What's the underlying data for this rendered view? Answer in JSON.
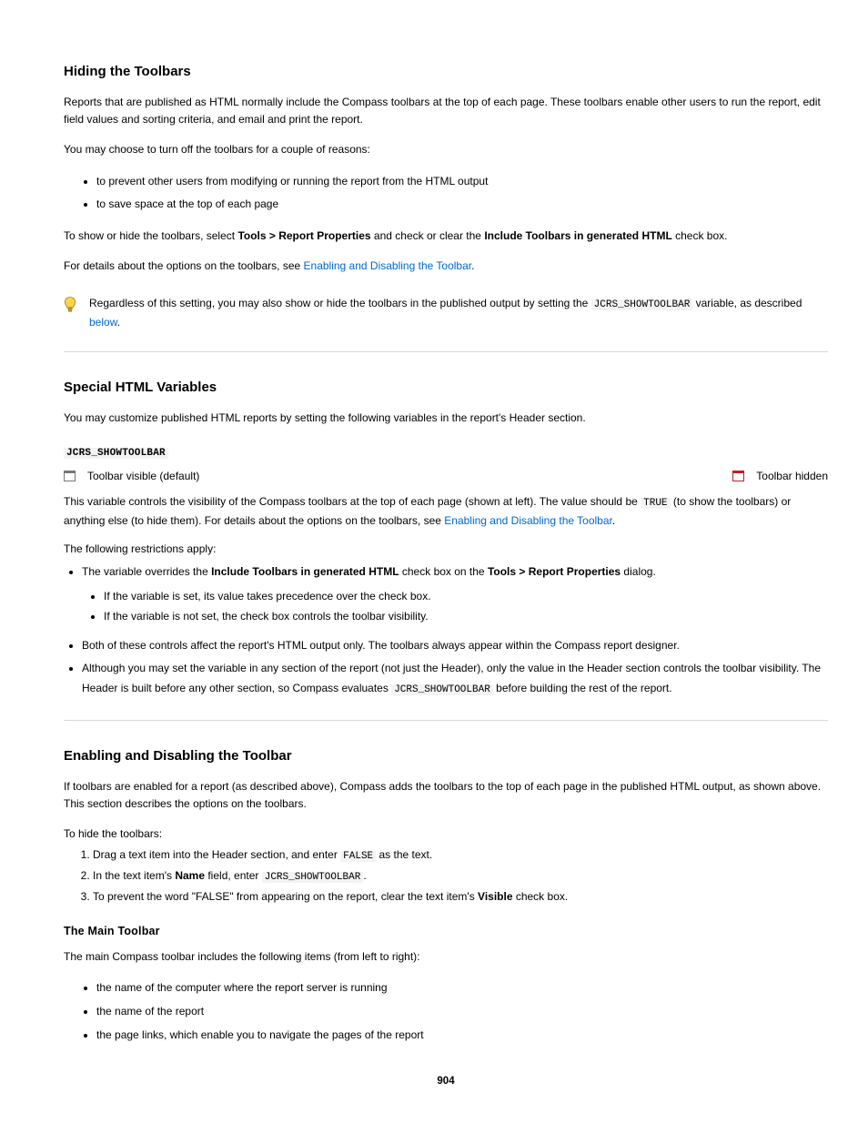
{
  "sec1": {
    "title": "Hiding the Toolbars",
    "p1": "Reports that are published as HTML normally include the Compass toolbars at the top of each page. These toolbars enable other users to run the report, edit field values and sorting criteria, and email and print the report.",
    "p2": "You may choose to turn off the toolbars for a couple of reasons:",
    "bullets": [
      "to prevent other users from modifying or running the report from the HTML output",
      "to save space at the top of each page"
    ],
    "p3_a": "To show or hide the toolbars, select ",
    "p3_b": " and check or clear the ",
    "p3_c": " check box.",
    "menu": "Tools > Report Properties",
    "checkbox": "Include Toolbars in generated HTML",
    "link_text": "Enabling and Disabling the Toolbar",
    "link_suffix": ".",
    "p4": "For details about the options on the toolbars, see ",
    "tip_a": "Regardless of this setting, you may also show or hide the toolbars in the published output by setting the ",
    "tip_b": " variable, as described ",
    "tip_c": ".",
    "tip_var": "JCRS_SHOWTOOLBAR",
    "below": "below"
  },
  "sec2": {
    "heading": "Special HTML Variables",
    "p1": "You may customize published HTML reports by setting the following variables in the report's Header section.",
    "var1": {
      "name": "JCRS_SHOWTOOLBAR",
      "icon_text": "Toolbar visible (default)",
      "icon2_text": "Toolbar hidden"
    },
    "p2_a": "This variable controls the visibility of the Compass toolbars at the top of each page (shown at left). The value should be ",
    "p2_b": " (to show the toolbars) or anything else (to hide them). For details about the options on the toolbars, see ",
    "p2_c": ".",
    "true": "TRUE",
    "link2_text": "Enabling and Disabling the Toolbar",
    "steps_intro": "To hide the toolbars:",
    "restrictions": "The following restrictions apply:",
    "bullets2_a_pre": "The variable overrides the ",
    "bullets2_a_mid": " check box on the ",
    "bullets2_a_post": " dialog.",
    "bullets2_chk": "Include Toolbars in generated HTML",
    "bullets2_dlg": "Tools > Report Properties",
    "nested": [
      "If the variable is set, its value takes precedence over the check box.",
      "If the variable is not set, the check box controls the toolbar visibility."
    ],
    "bullets3": "Both of these controls affect the report's HTML output only. The toolbars always appear within the Compass report designer.",
    "bullets4_a": "Although you may set the variable in any section of the report (not just the Header), only the value in the Header section controls the toolbar visibility. The Header is built before any other section, so Compass evaluates ",
    "bullets4_b": " before building the rest of the report.",
    "var_again": "JCRS_SHOWTOOLBAR"
  },
  "sec3": {
    "heading": "Enabling and Disabling the Toolbar",
    "p1": "If toolbars are enabled for a report (as described above), Compass adds the toolbars to the top of each page in the published HTML output, as shown above. This section describes the options on the toolbars.",
    "sub": "The Main Toolbar",
    "p2": "The main Compass toolbar includes the following items (from left to right):",
    "steps": {
      "s1_a": "Drag a text item into the Header section, and enter ",
      "s1_b": " as the text.",
      "s1_val": "FALSE",
      "s2_a": "In the text item's ",
      "s2_b": " field, enter ",
      "s2_c": ".",
      "s2_name": "Name",
      "s2_val": "JCRS_SHOWTOOLBAR",
      "s3_a": "To prevent the word \"FALSE\" from appearing on the report, clear the text item's ",
      "s3_b": " check box.",
      "s3_chk": "Visible"
    },
    "bullets": [
      "the name of the computer where the report server is running",
      "the name of the report",
      "the page links, which enable you to navigate the pages of the report"
    ]
  },
  "pagenum": "904"
}
